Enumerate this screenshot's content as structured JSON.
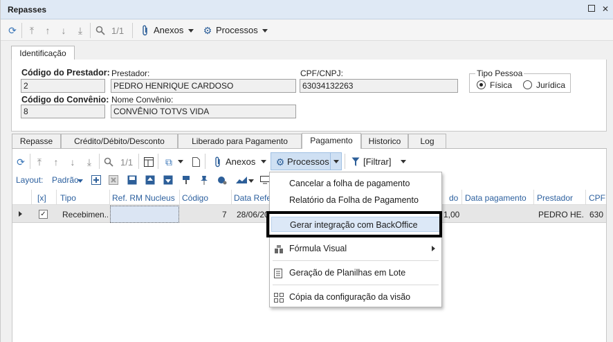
{
  "window": {
    "title": "Repasses"
  },
  "toolbar": {
    "pager": "1/1",
    "anexos_label": "Anexos",
    "processos_label": "Processos"
  },
  "header_tab": {
    "label": "Identificação"
  },
  "form": {
    "codigo_prestador_label": "Código do Prestador:",
    "codigo_prestador_value": "2",
    "prestador_label": "Prestador:",
    "prestador_value": "PEDRO HENRIQUE CARDOSO",
    "cpf_label": "CPF/CNPJ:",
    "cpf_value": "63034132263",
    "tipo_pessoa_label": "Tipo Pessoa",
    "tipo_fisica": "Física",
    "tipo_juridica": "Jurídica",
    "tipo_selected": "Física",
    "codigo_convenio_label": "Código do Convênio:",
    "codigo_convenio_value": "8",
    "nome_convenio_label": "Nome Convênio:",
    "nome_convenio_value": "CONVÊNIO TOTVS  VIDA"
  },
  "tabs": [
    {
      "label": "Repasse"
    },
    {
      "label": "Crédito/Débito/Desconto"
    },
    {
      "label": "Liberado para Pagamento"
    },
    {
      "label": "Pagamento"
    },
    {
      "label": "Historico"
    },
    {
      "label": "Log"
    }
  ],
  "active_tab": "Pagamento",
  "inner_toolbar": {
    "pager": "1/1",
    "anexos_label": "Anexos",
    "processos_label": "Processos",
    "filtrar_label": "[Filtrar]",
    "layout_label": "Layout:",
    "layout_value": "Padrão"
  },
  "grid": {
    "headers": [
      "[x]",
      "Tipo",
      "Ref. RM Nucleus",
      "Código",
      "Data Refer",
      "do",
      "Data pagamento",
      "Prestador",
      "CPF"
    ],
    "row": {
      "tipo": "Recebimen...",
      "ref": "",
      "codigo": "7",
      "data_ref": "28/06/20",
      "valor": "1,00",
      "data_pagamento": "",
      "prestador": "PEDRO HE...",
      "cpf": "630"
    }
  },
  "menu": {
    "items": [
      {
        "label": "Cancelar a folha de pagamento"
      },
      {
        "label": "Relatório da Folha de Pagamento"
      },
      {
        "label": "Gerar integração com BackOffice"
      },
      {
        "label": "Fórmula Visual"
      },
      {
        "label": "Geração de Planilhas em Lote"
      },
      {
        "label": "Cópia da configuração da visão"
      }
    ]
  },
  "colors": {
    "accent": "#3a76b8",
    "menu_highlight": "#dce8f7",
    "title_bar": "#dfe9f5"
  }
}
